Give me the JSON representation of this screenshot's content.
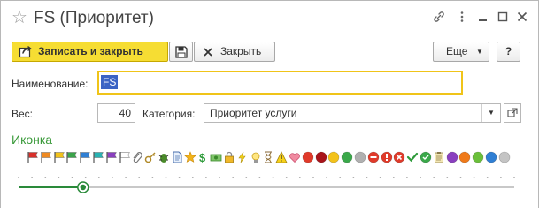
{
  "window": {
    "title": "FS (Приоритет)"
  },
  "toolbar": {
    "save_close_label": "Записать и закрыть",
    "close_label": "Закрыть",
    "more_label": "Еще",
    "help_label": "?"
  },
  "form": {
    "name_label": "Наименование:",
    "name_value": "FS",
    "weight_label": "Вес:",
    "weight_value": "40",
    "category_label": "Категория:",
    "category_value": "Приоритет услуги"
  },
  "icon_section": {
    "title": "Иконка",
    "icons": [
      "red-flag-icon",
      "orange-flag-icon",
      "yellow-flag-icon",
      "green-flag-icon",
      "blue-flag-icon",
      "teal-flag-icon",
      "purple-flag-icon",
      "white-flag-icon",
      "paperclip-icon",
      "key-icon",
      "bug-icon",
      "document-icon",
      "star-icon",
      "dollar-icon",
      "money-icon",
      "lock-icon",
      "lightning-icon",
      "lightbulb-icon",
      "hourglass-icon",
      "warning-icon",
      "heart-icon",
      "red-circle-icon",
      "dark-red-circle-icon",
      "yellow-circle-icon",
      "green-circle-icon",
      "gray-circle-icon",
      "stop-icon",
      "minus-circle-icon",
      "error-icon",
      "check-icon",
      "check-circle-icon",
      "clipboard-icon",
      "purple-circle-icon",
      "orange-circle-icon",
      "green-circle-2-icon",
      "blue-circle-icon",
      "gray-circle-2-icon"
    ],
    "slider_position": 0.13
  },
  "colors": {
    "accent_yellow": "#f6dd33",
    "section_green": "#3a9a3a",
    "selection_blue": "#3b63c4"
  }
}
